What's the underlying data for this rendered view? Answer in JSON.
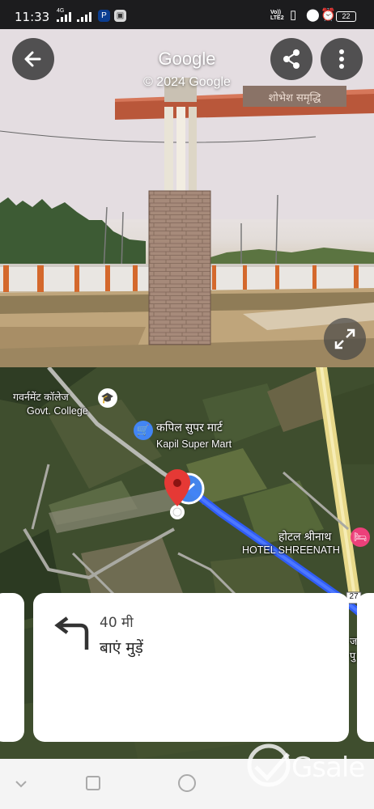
{
  "status_bar": {
    "time": "11:33",
    "network_label": "4G",
    "volte_top": "Vo))",
    "volte_bottom": "LTE2",
    "battery": "22"
  },
  "street_view": {
    "title": "Google",
    "copyright": "© 2024 Google",
    "gate_sign": "शोभेश समृद्धि",
    "back_icon": "arrow-left-icon",
    "share_icon": "share-icon",
    "menu_icon": "more-vertical-icon",
    "expand_icon": "expand-icon"
  },
  "map": {
    "labels": {
      "college_hi": "गवर्नमेंट कॉलेज",
      "college_en": "Govt. College",
      "mart_hi": "कपिल सुपर मार्ट",
      "mart_en": "Kapil Super Mart",
      "hotel_hi": "होटल श्रीनाथ",
      "hotel_en": "HOTEL SHREENATH",
      "route_shield": "27",
      "partial_right": "ज",
      "partial_right2": "पु"
    },
    "colors": {
      "route": "#2f5cf5",
      "highway": "#e8d98a",
      "pin": "#e53935",
      "location": "#4285f4"
    }
  },
  "navigation": {
    "distance": "40 मी",
    "instruction": "बाएं मुड़ें",
    "turn_icon": "turn-left-icon"
  },
  "nav_bar": {
    "back": "chevron-down-icon",
    "home": "circle-icon",
    "recents": "square-icon"
  },
  "watermark": "Gsale"
}
